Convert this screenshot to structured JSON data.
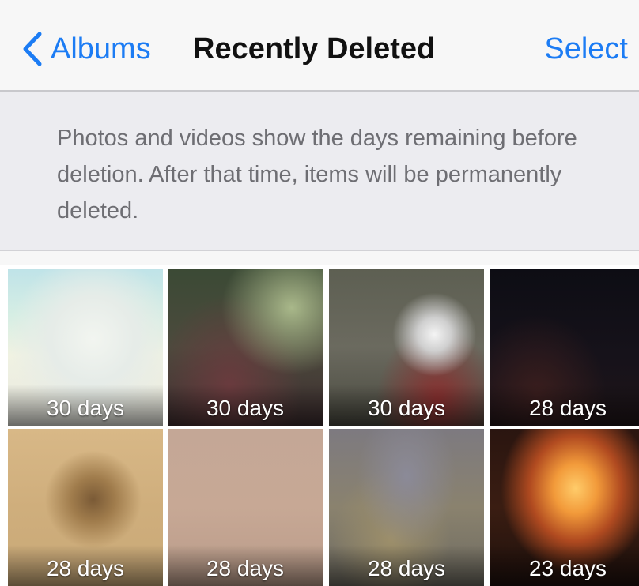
{
  "navbar": {
    "back_label": "Albums",
    "title": "Recently Deleted",
    "select_label": "Select",
    "back_icon": "chevron-left-icon",
    "accent_color": "#1c7cf4"
  },
  "info": {
    "text": "Photos and videos show the days remaining before deletion. After that time, items will be permanently deleted."
  },
  "photos": [
    {
      "days": "30 days"
    },
    {
      "days": "30 days"
    },
    {
      "days": "30 days"
    },
    {
      "days": "28 days"
    },
    {
      "days": "28 days"
    },
    {
      "days": "28 days"
    },
    {
      "days": "28 days"
    },
    {
      "days": "23 days"
    }
  ]
}
